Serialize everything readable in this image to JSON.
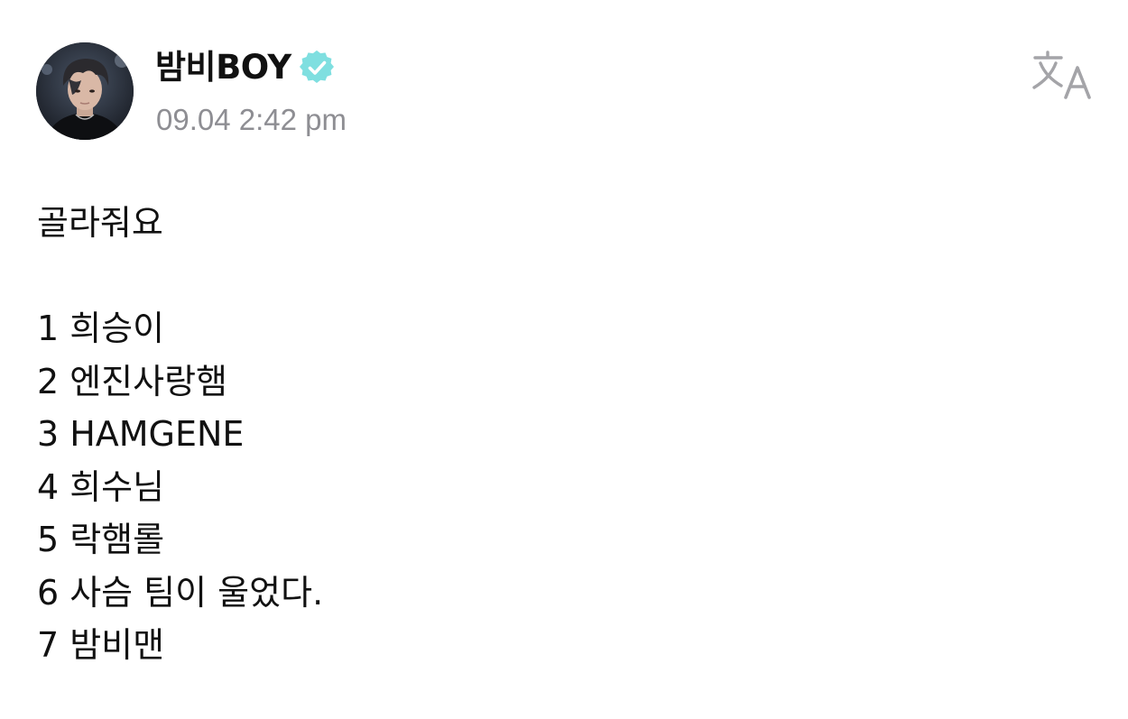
{
  "post": {
    "author": {
      "name": "밤비BOY",
      "verified": true,
      "avatar_icon": "profile-photo",
      "badge_color": "#7fdfe0"
    },
    "timestamp": "09.04 2:42 pm",
    "translate_icon": "translate-icon",
    "body": {
      "intro": "골라줘요",
      "options": [
        {
          "number": "1",
          "text": "희승이"
        },
        {
          "number": "2",
          "text": "엔진사랑햄"
        },
        {
          "number": "3",
          "text": "HAMGENE"
        },
        {
          "number": "4",
          "text": "희수님"
        },
        {
          "number": "5",
          "text": "락햄롤"
        },
        {
          "number": "6",
          "text": "사슴 팀이 울었다."
        },
        {
          "number": "7",
          "text": "밤비맨"
        }
      ]
    }
  }
}
